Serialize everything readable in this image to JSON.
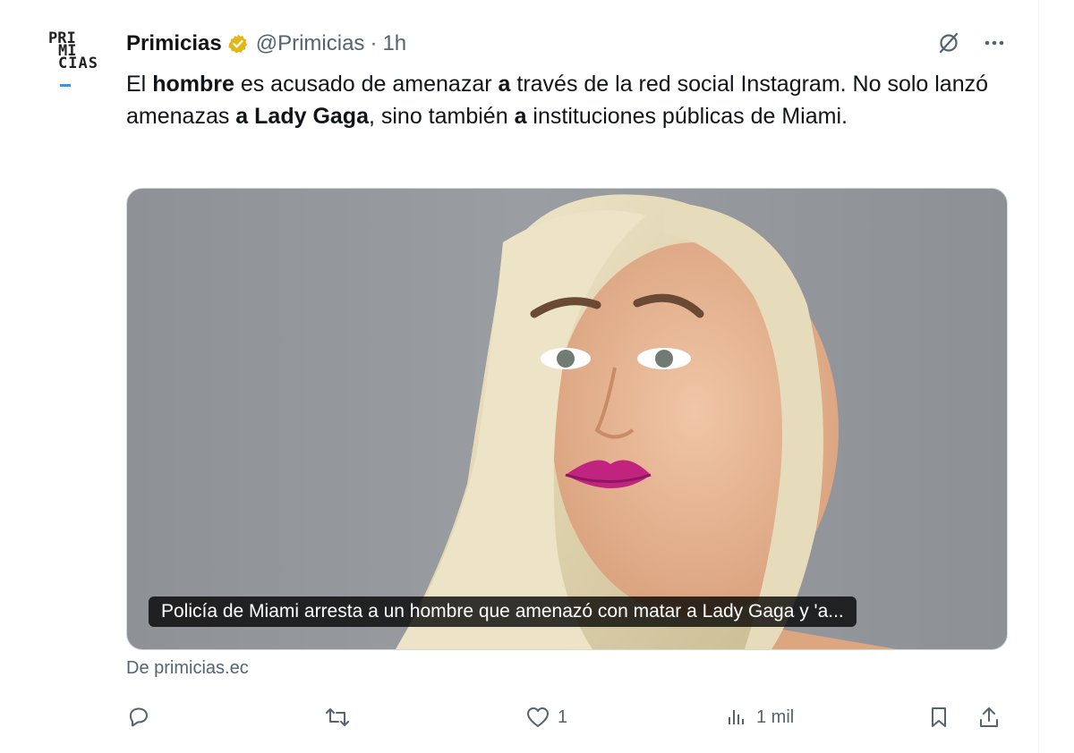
{
  "tweet": {
    "author_name": "Primicias",
    "handle": "@Primicias",
    "separator": "·",
    "time": "1h",
    "avatar_logo": "PRIMICIAS",
    "text": {
      "p1": "El ",
      "b1": "hombre",
      "p2": " es acusado de amenazar ",
      "b2": "a",
      "p3": " través de la red social Instagram. No solo lanzó amenazas ",
      "b3": "a Lady Gaga",
      "p4": ", sino también ",
      "b4": "a",
      "p5": " instituciones públicas de Miami."
    },
    "card": {
      "caption": "Policía de Miami arresta a un hombre que amenazó con matar a Lady Gaga y 'a...",
      "source": "De primicias.ec"
    },
    "actions": {
      "reply_count": "",
      "retweet_count": "",
      "like_count": "1",
      "views_count": "1 mil"
    },
    "icons": {
      "verified": "verified-badge-icon",
      "grok": "grok-icon",
      "more": "more-icon",
      "reply": "reply-icon",
      "retweet": "retweet-icon",
      "like": "heart-icon",
      "views": "views-icon",
      "bookmark": "bookmark-icon",
      "share": "share-icon"
    },
    "colors": {
      "verified_gold": "#e2b719",
      "secondary_text": "#536471"
    }
  }
}
